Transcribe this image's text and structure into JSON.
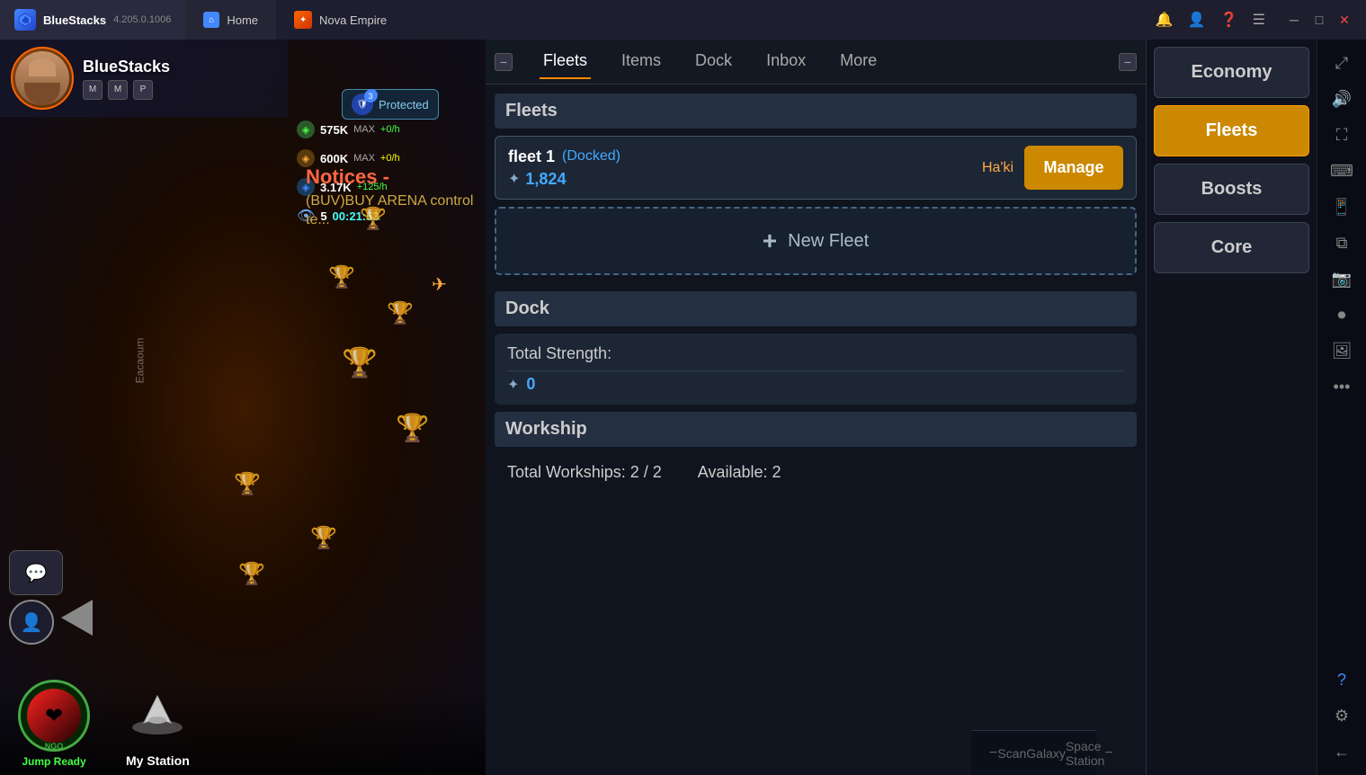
{
  "titleBar": {
    "appName": "BlueStacks",
    "appVersion": "4.205.0.1006",
    "homeTabLabel": "Home",
    "gameTabLabel": "Nova Empire"
  },
  "player": {
    "name": "BlueStacks",
    "icons": [
      "M",
      "M",
      "P"
    ]
  },
  "resources": [
    {
      "type": "green",
      "value": "575K",
      "max": "MAX",
      "rate": "+0/h"
    },
    {
      "type": "orange",
      "value": "600K",
      "max": "MAX",
      "rate": "+0/h"
    },
    {
      "type": "blue",
      "value": "3.17K",
      "rate": "+125/h"
    },
    {
      "type": "purple",
      "level": "5",
      "timer": "00:21:53"
    }
  ],
  "protected": {
    "label": "Protected",
    "shieldLevel": "3"
  },
  "notices": {
    "title": "Notices",
    "subtitle": "(BUV)BUY ARENA control te..."
  },
  "mapLabel": "Eacaoum",
  "bottomBar": {
    "jumpReady": "Jump Ready",
    "ngoLabel": "NGO",
    "myStation": "My Station"
  },
  "gamePanel": {
    "tabs": [
      {
        "label": "Fleets",
        "active": true
      },
      {
        "label": "Items",
        "active": false
      },
      {
        "label": "Dock",
        "active": false
      },
      {
        "label": "Inbox",
        "active": false
      },
      {
        "label": "More",
        "active": false
      }
    ],
    "fleets": {
      "title": "Fleets",
      "fleet1": {
        "name": "fleet 1",
        "status": "(Docked)",
        "owner": "Ha'ki",
        "strength": "1,824",
        "manageLabel": "Manage"
      },
      "newFleetLabel": "New Fleet"
    },
    "dock": {
      "title": "Dock",
      "totalStrengthLabel": "Total Strength:",
      "strengthValue": "0"
    },
    "workship": {
      "title": "Workship",
      "totalLabel": "Total Workships: 2 / 2",
      "availableLabel": "Available: 2"
    }
  },
  "rightSidebar": {
    "buttons": [
      {
        "label": "Economy",
        "active": false
      },
      {
        "label": "Fleets",
        "active": true
      },
      {
        "label": "Boosts",
        "active": false
      },
      {
        "label": "Core",
        "active": false
      }
    ]
  },
  "bottomUIBar": {
    "items": [
      "Scan",
      "Galaxy",
      "Space Station"
    ],
    "minimizeLeft": "−",
    "minimizeRight": "−"
  }
}
